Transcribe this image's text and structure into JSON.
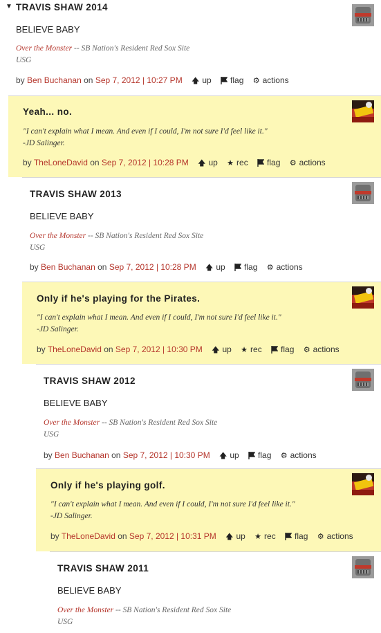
{
  "actions": {
    "up": "up",
    "rec": "rec",
    "flag": "flag",
    "actions": "actions"
  },
  "by_label": "by",
  "on_label": "on",
  "comments": [
    {
      "title": "TRAVIS SHAW 2014",
      "body": "BELIEVE BABY",
      "sig_link": "Over the Monster",
      "sig_rest": " -- SB Nation's Resident Red Sox Site",
      "sig_line2": "USG",
      "author": "Ben Buchanan",
      "timestamp": "Sep 7, 2012 | 10:27 PM"
    },
    {
      "title": "Yeah... no.",
      "quote_line1": "\"I can't explain what I mean. And even if I could, I'm not sure I'd feel like it.\"",
      "quote_line2": "-JD Salinger.",
      "author": "TheLoneDavid",
      "timestamp": "Sep 7, 2012 | 10:28 PM"
    },
    {
      "title": "TRAVIS SHAW 2013",
      "body": "BELIEVE BABY",
      "sig_link": "Over the Monster",
      "sig_rest": " -- SB Nation's Resident Red Sox Site",
      "sig_line2": "USG",
      "author": "Ben Buchanan",
      "timestamp": "Sep 7, 2012 | 10:28 PM"
    },
    {
      "title": "Only if he's playing for the Pirates.",
      "quote_line1": "\"I can't explain what I mean. And even if I could, I'm not sure I'd feel like it.\"",
      "quote_line2": "-JD Salinger.",
      "author": "TheLoneDavid",
      "timestamp": "Sep 7, 2012 | 10:30 PM"
    },
    {
      "title": "TRAVIS SHAW 2012",
      "body": "BELIEVE BABY",
      "sig_link": "Over the Monster",
      "sig_rest": " -- SB Nation's Resident Red Sox Site",
      "sig_line2": "USG",
      "author": "Ben Buchanan",
      "timestamp": "Sep 7, 2012 | 10:30 PM"
    },
    {
      "title": "Only if he's playing golf.",
      "quote_line1": "\"I can't explain what I mean. And even if I could, I'm not sure I'd feel like it.\"",
      "quote_line2": "-JD Salinger.",
      "author": "TheLoneDavid",
      "timestamp": "Sep 7, 2012 | 10:31 PM"
    },
    {
      "title": "TRAVIS SHAW 2011",
      "body": "BELIEVE BABY",
      "sig_link": "Over the Monster",
      "sig_rest": " -- SB Nation's Resident Red Sox Site",
      "sig_line2": "USG"
    }
  ]
}
